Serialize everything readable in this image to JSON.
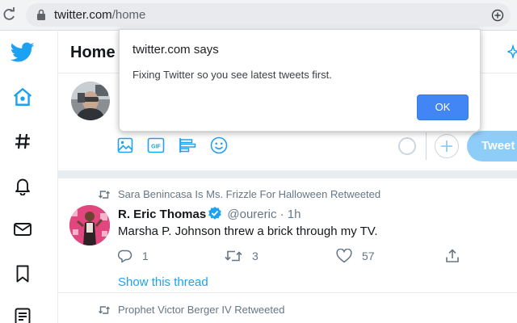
{
  "browser": {
    "url_host": "twitter.com",
    "url_path": "/home"
  },
  "nav": {
    "items": [
      {
        "icon": "twitter-bird-icon"
      },
      {
        "icon": "home-icon"
      },
      {
        "icon": "hashtag-icon"
      },
      {
        "icon": "bell-icon"
      },
      {
        "icon": "mail-icon"
      },
      {
        "icon": "bookmark-icon"
      },
      {
        "icon": "list-icon"
      }
    ]
  },
  "header": {
    "title": "Home"
  },
  "composer": {
    "tweet_button": "Tweet",
    "tools": [
      "image-icon",
      "gif-icon",
      "poll-icon",
      "emoji-icon"
    ]
  },
  "timeline": {
    "tweets": [
      {
        "retweeted_by": "Sara Benincasa Is Ms. Frizzle For Halloween Retweeted",
        "display_name": "R. Eric Thomas",
        "handle": "@oureric",
        "time": "· 1h",
        "text": "Marsha P. Johnson threw a brick through my TV.",
        "replies": "1",
        "retweets": "3",
        "likes": "57",
        "show_thread": "Show this thread"
      },
      {
        "retweeted_by": "Prophet Victor Berger IV Retweeted"
      }
    ]
  },
  "dialog": {
    "title": "twitter.com says",
    "message": "Fixing Twitter so you see latest tweets first.",
    "ok_label": "OK"
  },
  "colors": {
    "accent": "#1da1f2",
    "ok_button": "#4285f4",
    "tweet_button_disabled": "#8ecdf8"
  }
}
